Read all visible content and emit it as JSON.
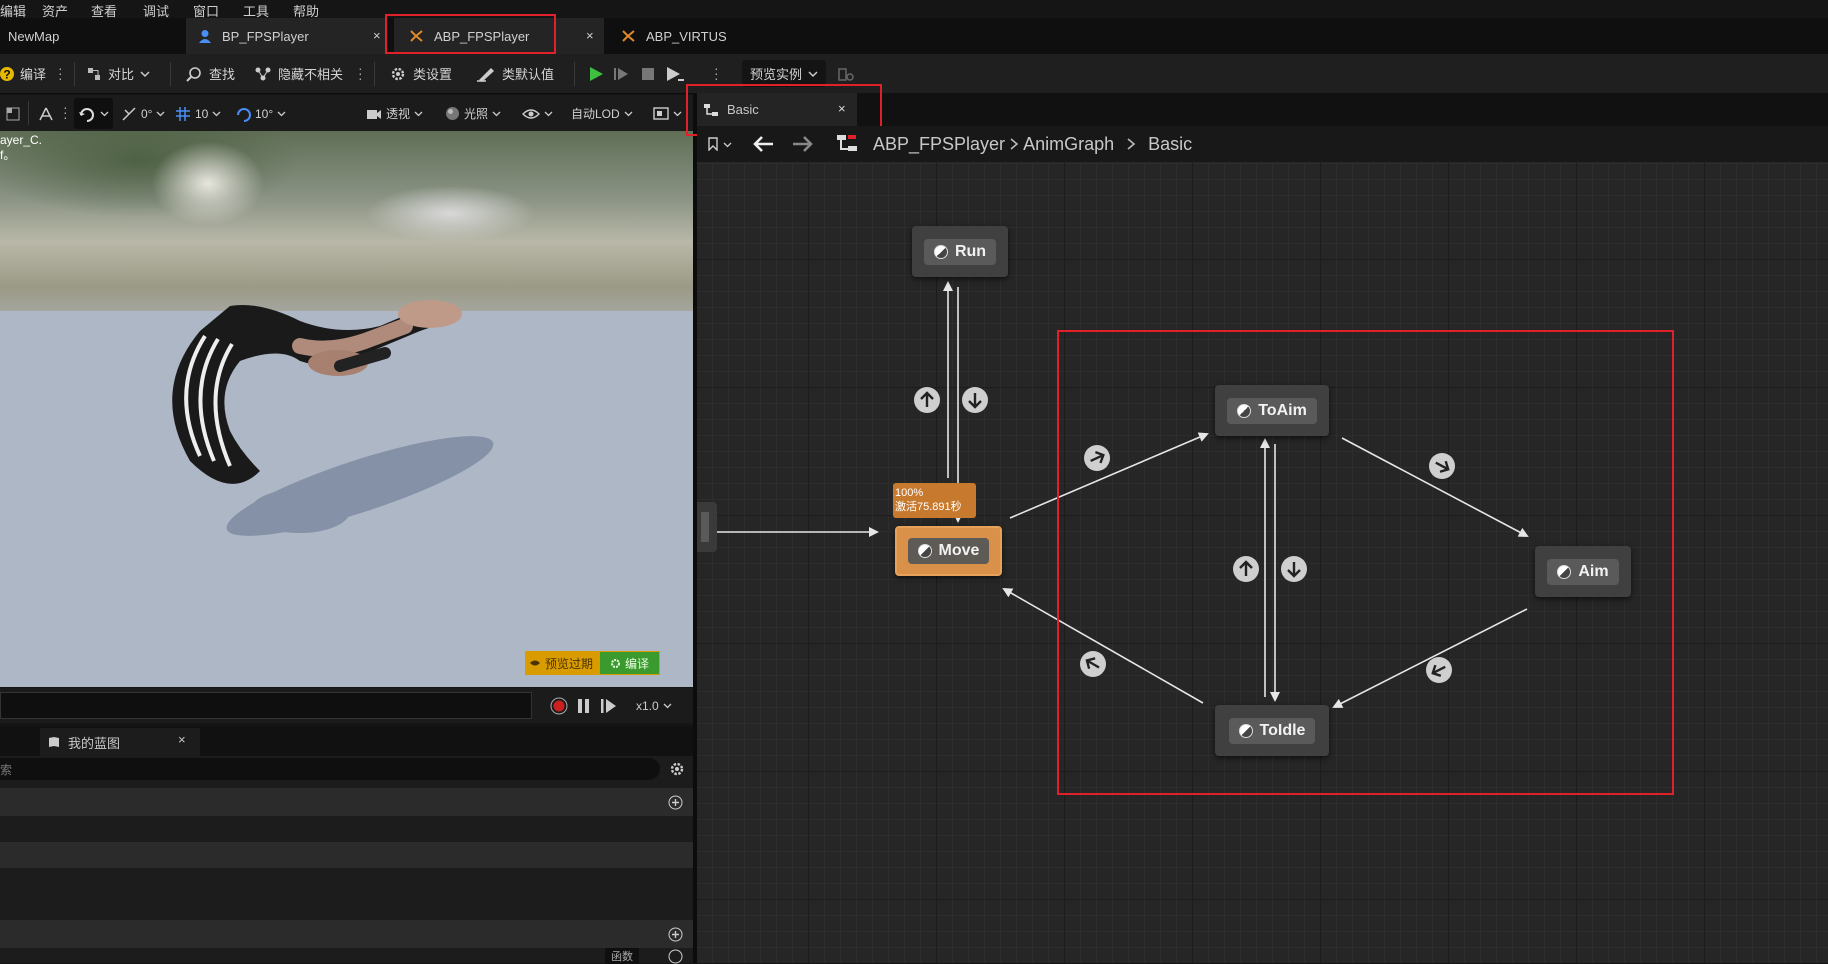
{
  "menu": [
    "编辑",
    "资产",
    "查看",
    "调试",
    "窗口",
    "工具",
    "帮助"
  ],
  "tabs": {
    "map": "NewMap",
    "items": [
      {
        "label": "BP_FPSPlayer",
        "close": "×"
      },
      {
        "label": "ABP_FPSPlayer",
        "close": "×"
      },
      {
        "label": "ABP_VIRTUS"
      }
    ]
  },
  "toolbar": {
    "compile": "编译",
    "diff": "对比",
    "find": "查找",
    "hide_unrelated": "隐藏不相关",
    "class_settings": "类设置",
    "class_defaults": "类默认值",
    "preview_instance": "预览实例"
  },
  "viewport_toolbar": {
    "snap_rot": "0°",
    "grid": "10",
    "angle": "10°",
    "perspective": "透视",
    "lighting": "光照",
    "lod": "自动LOD"
  },
  "viewport": {
    "overlay_line1": "ayer_C.",
    "overlay_line2": "f。",
    "preview_expired": "预览过期",
    "compile": "编译"
  },
  "timeline": {
    "speed": "x1.0"
  },
  "panel": {
    "tab": "我的蓝图",
    "close": "×",
    "search_placeholder": "索",
    "bottom_label": "函数"
  },
  "graph": {
    "tab": "Basic",
    "tab_close": "×",
    "breadcrumb": [
      "ABP_FPSPlayer",
      "AnimGraph",
      "Basic"
    ],
    "states": {
      "run": "Run",
      "move": "Move",
      "to_aim": "ToAim",
      "aim": "Aim",
      "to_idle": "ToIdle"
    },
    "active_tooltip": {
      "percent": "100%",
      "active_time": "激活75.891秒"
    }
  },
  "colors": {
    "highlight_red": "#e0202a",
    "active_state": "#d9914a",
    "play_green": "#3fbf3f",
    "status_yellow": "#e1a400",
    "status_green": "#2f9a2f"
  }
}
